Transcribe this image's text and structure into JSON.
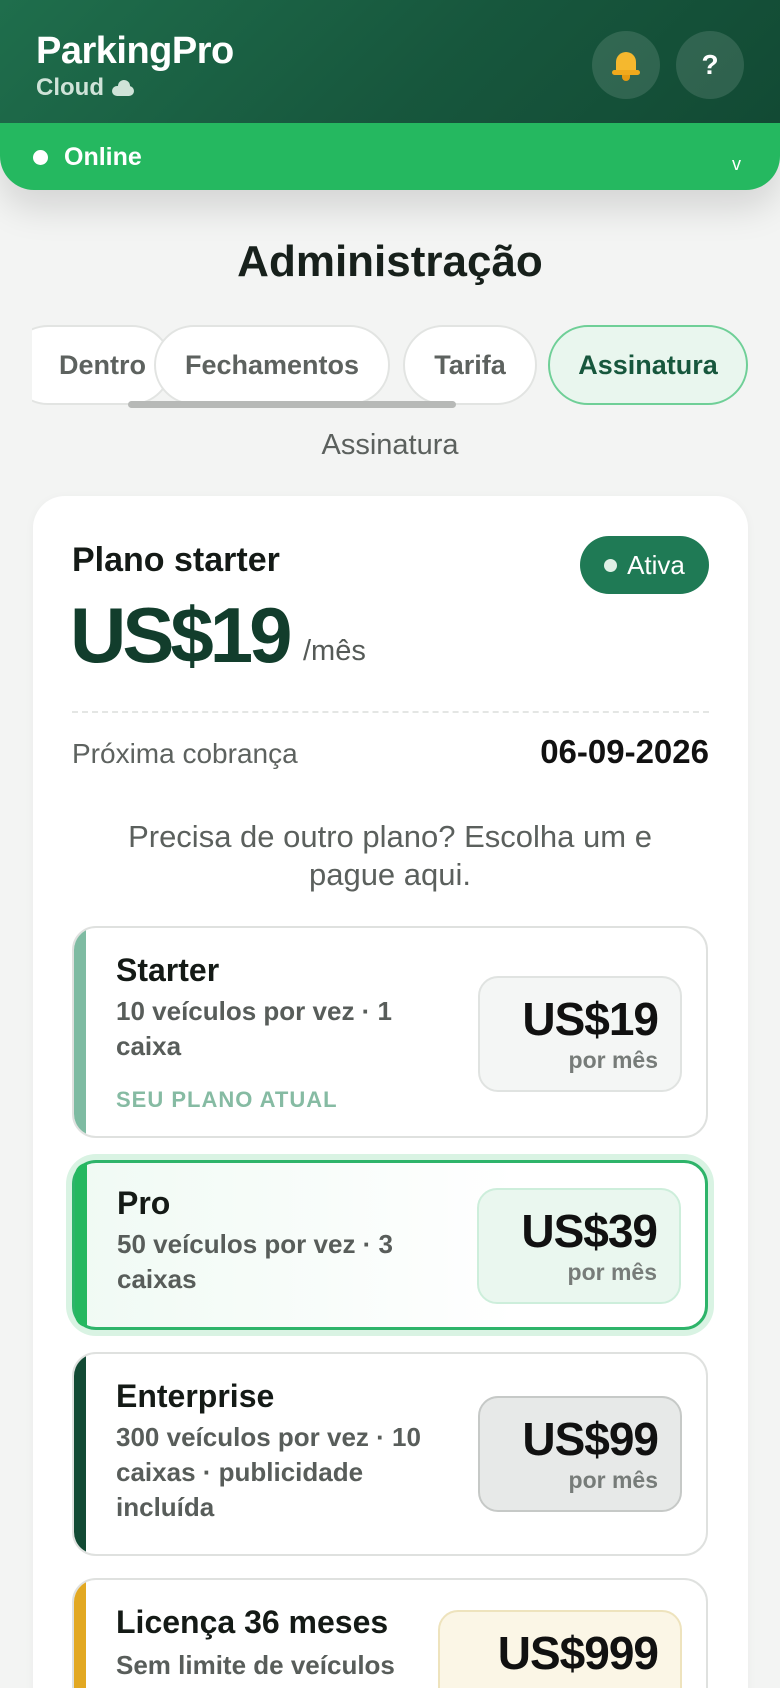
{
  "header": {
    "brand_name": "ParkingPro",
    "brand_sub": "Cloud",
    "help_label": "?",
    "status": "Online",
    "status_chevron": "v",
    "icons": [
      "cloud-icon",
      "bell-icon",
      "help-icon",
      "chevron-down-icon"
    ]
  },
  "page": {
    "title": "Administração",
    "section_subtitle": "Assinatura"
  },
  "tabs": [
    {
      "label": "Dentro",
      "active": false
    },
    {
      "label": "Fechamentos",
      "active": false
    },
    {
      "label": "Tarifa",
      "active": false
    },
    {
      "label": "Assinatura",
      "active": true
    }
  ],
  "subscription": {
    "plan_name": "Plano starter",
    "badge": "Ativa",
    "price": "US$19",
    "unit": "/mês",
    "next_charge_label": "Próxima cobrança",
    "next_charge_date": "06-09-2026",
    "helper": "Precisa de outro plano? Escolha um e pague aqui."
  },
  "plans": [
    {
      "name": "Starter",
      "desc": "10 veículos por vez · 1 caixa",
      "tag": "SEU PLANO ATUAL",
      "price": "US$19",
      "per": "por mês",
      "accent": "#7ebba2"
    },
    {
      "name": "Pro",
      "desc": "50 veículos por vez · 3 caixas",
      "price": "US$39",
      "per": "por mês",
      "accent": "#25b860"
    },
    {
      "name": "Enterprise",
      "desc": "300 veículos por vez · 10 caixas · publicidade incluída",
      "price": "US$99",
      "per": "por mês",
      "accent": "#124a34"
    },
    {
      "name": "Licença 36 meses",
      "desc": "Sem limite de veículos",
      "price": "US$999",
      "accent": "#e2a822"
    }
  ],
  "colors": {
    "header_dark": "#17573d",
    "header_green": "#25b860",
    "badge": "#1f7a55",
    "price": "#123d2c"
  }
}
